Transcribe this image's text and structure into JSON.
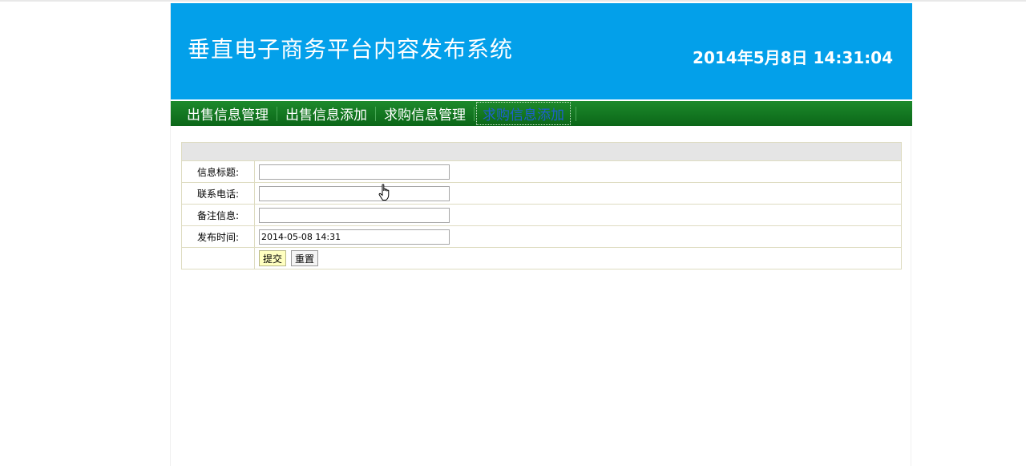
{
  "header": {
    "title": "垂直电子商务平台内容发布系统",
    "clock": "2014年5月8日  14:31:04",
    "background": "#03a0ea"
  },
  "nav": {
    "items": [
      {
        "label": "出售信息管理",
        "active": false
      },
      {
        "label": "出售信息添加",
        "active": false
      },
      {
        "label": "求购信息管理",
        "active": false
      },
      {
        "label": "求购信息添加",
        "active": true
      }
    ],
    "background": "#0b6618"
  },
  "form": {
    "fields": [
      {
        "label": "信息标题:",
        "value": ""
      },
      {
        "label": "联系电话:",
        "value": ""
      },
      {
        "label": "备注信息:",
        "value": ""
      },
      {
        "label": "发布时间:",
        "value": "2014-05-08 14:31"
      }
    ],
    "submit_label": "提交",
    "reset_label": "重置"
  },
  "cursor": {
    "icon": "hand-pointer-icon"
  }
}
